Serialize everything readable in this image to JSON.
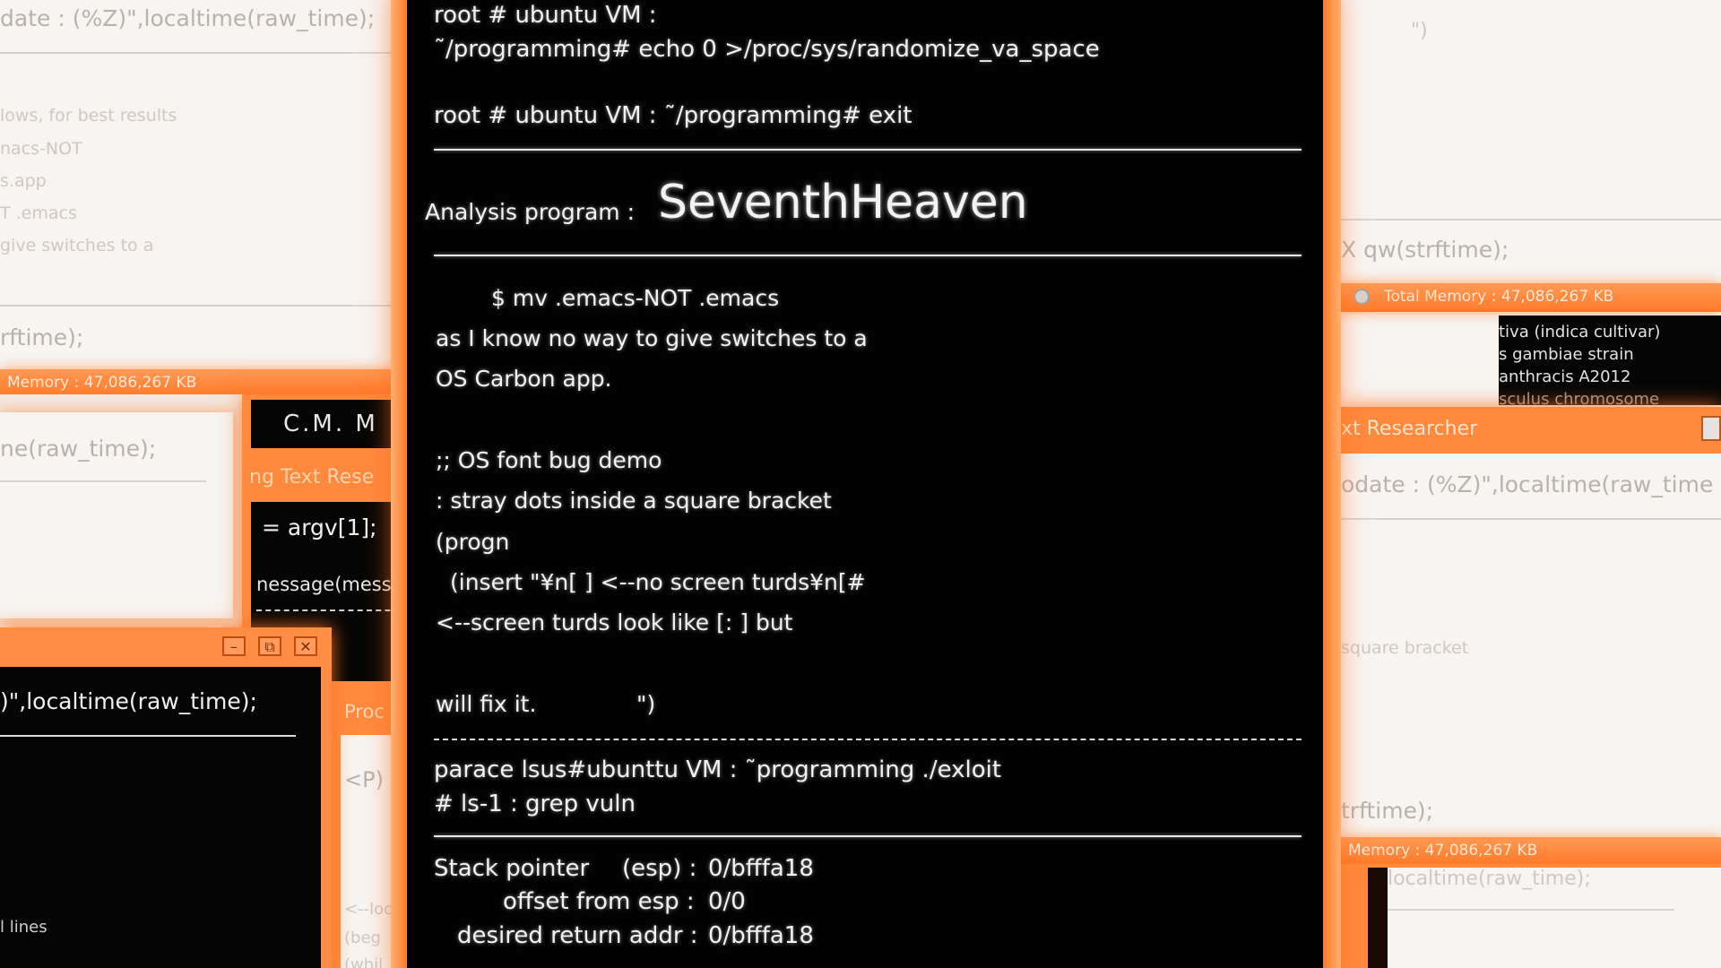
{
  "terminal": {
    "lines_top": [
      "root # ubuntu VM :",
      "˜/programming# echo 0 >/proc/sys/randomize_va_space",
      "root # ubuntu VM : ˜/programming# exit"
    ],
    "analysis_label": "Analysis program :",
    "analysis_name": "SeventhHeaven",
    "code_lines": [
      "$ mv .emacs-NOT .emacs",
      "as I know no way to give switches to a",
      "OS Carbon app.",
      ";; OS font bug demo",
      ": stray dots inside a square bracket",
      "(progn",
      "(insert \"¥n[ ] <--no screen turds¥n[#",
      "<--screen turds look like [: ] but",
      "will fix it.",
      "\")"
    ],
    "exploit_lines": [
      "parace lsus#ubunttu VM : ˜programming ./exloit",
      "# ls-1 : grep vuln"
    ],
    "stack": [
      {
        "label": "Stack pointer",
        "reg": "(esp) :",
        "value": "0/bfffa18"
      },
      {
        "label": "offset from esp :",
        "reg": "",
        "value": "0/0"
      },
      {
        "label": "desired return addr :",
        "reg": "",
        "value": "0/bfffa18"
      }
    ]
  },
  "left_top_window": {
    "header_text": "date : (%Z)\",localtime(raw_time);",
    "lines": [
      "lows, for best results",
      "nacs-NOT",
      "s.app",
      "T .emacs",
      "give switches to a"
    ],
    "footer_text": "rftime);",
    "memory_bar": "Memory : 47,086,267 KB"
  },
  "left_mid_window": {
    "text": "ne(raw_time);"
  },
  "left_orange_window": {
    "row1": "C.M. M",
    "row2": "ng Text Rese",
    "row3": "= argv[1];",
    "row4": "nessage(mess",
    "prog_label": "Proc",
    "frag": "<P)",
    "frag2": "<--lool",
    "frag3": "(beg",
    "frag4": "(whil"
  },
  "left_bottom_window": {
    "text": ")\",localtime(raw_time);",
    "footer": "l lines",
    "btn_min": "–",
    "btn_max": "⧉",
    "btn_close": "✕"
  },
  "right_top_window": {
    "quote": "\")",
    "text": "X qw(strftime);",
    "memory_bar": "Total Memory : 47,086,267 KB",
    "list": [
      "tiva (indica cultivar)",
      "s gambiae strain",
      "anthracis A2012",
      "sculus chromosome"
    ]
  },
  "right_researcher_window": {
    "title": "xt Researcher",
    "text": "odate : (%Z)\",localtime(raw_time",
    "mid_text": "square bracket",
    "footer_text": "trftime);",
    "memory_bar": "Memory : 47,086,267 KB",
    "bottom_text": "localtime(raw_time);"
  }
}
